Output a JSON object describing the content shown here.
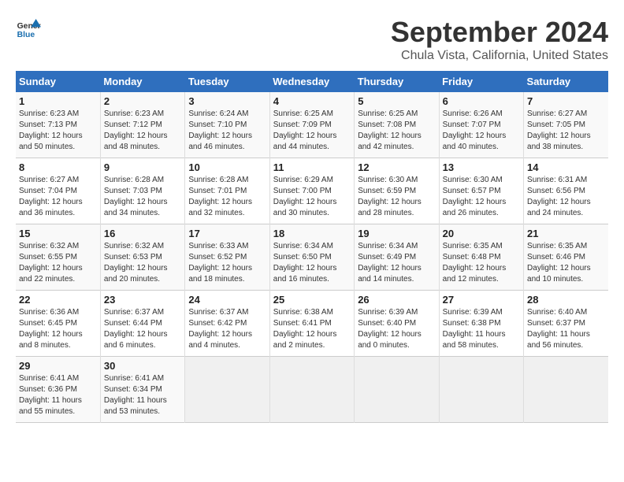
{
  "header": {
    "logo_line1": "General",
    "logo_line2": "Blue",
    "title": "September 2024",
    "subtitle": "Chula Vista, California, United States"
  },
  "columns": [
    "Sunday",
    "Monday",
    "Tuesday",
    "Wednesday",
    "Thursday",
    "Friday",
    "Saturday"
  ],
  "weeks": [
    [
      {
        "day": "1",
        "sunrise": "6:23 AM",
        "sunset": "7:13 PM",
        "daylight": "12 hours and 50 minutes."
      },
      {
        "day": "2",
        "sunrise": "6:23 AM",
        "sunset": "7:12 PM",
        "daylight": "12 hours and 48 minutes."
      },
      {
        "day": "3",
        "sunrise": "6:24 AM",
        "sunset": "7:10 PM",
        "daylight": "12 hours and 46 minutes."
      },
      {
        "day": "4",
        "sunrise": "6:25 AM",
        "sunset": "7:09 PM",
        "daylight": "12 hours and 44 minutes."
      },
      {
        "day": "5",
        "sunrise": "6:25 AM",
        "sunset": "7:08 PM",
        "daylight": "12 hours and 42 minutes."
      },
      {
        "day": "6",
        "sunrise": "6:26 AM",
        "sunset": "7:07 PM",
        "daylight": "12 hours and 40 minutes."
      },
      {
        "day": "7",
        "sunrise": "6:27 AM",
        "sunset": "7:05 PM",
        "daylight": "12 hours and 38 minutes."
      }
    ],
    [
      {
        "day": "8",
        "sunrise": "6:27 AM",
        "sunset": "7:04 PM",
        "daylight": "12 hours and 36 minutes."
      },
      {
        "day": "9",
        "sunrise": "6:28 AM",
        "sunset": "7:03 PM",
        "daylight": "12 hours and 34 minutes."
      },
      {
        "day": "10",
        "sunrise": "6:28 AM",
        "sunset": "7:01 PM",
        "daylight": "12 hours and 32 minutes."
      },
      {
        "day": "11",
        "sunrise": "6:29 AM",
        "sunset": "7:00 PM",
        "daylight": "12 hours and 30 minutes."
      },
      {
        "day": "12",
        "sunrise": "6:30 AM",
        "sunset": "6:59 PM",
        "daylight": "12 hours and 28 minutes."
      },
      {
        "day": "13",
        "sunrise": "6:30 AM",
        "sunset": "6:57 PM",
        "daylight": "12 hours and 26 minutes."
      },
      {
        "day": "14",
        "sunrise": "6:31 AM",
        "sunset": "6:56 PM",
        "daylight": "12 hours and 24 minutes."
      }
    ],
    [
      {
        "day": "15",
        "sunrise": "6:32 AM",
        "sunset": "6:55 PM",
        "daylight": "12 hours and 22 minutes."
      },
      {
        "day": "16",
        "sunrise": "6:32 AM",
        "sunset": "6:53 PM",
        "daylight": "12 hours and 20 minutes."
      },
      {
        "day": "17",
        "sunrise": "6:33 AM",
        "sunset": "6:52 PM",
        "daylight": "12 hours and 18 minutes."
      },
      {
        "day": "18",
        "sunrise": "6:34 AM",
        "sunset": "6:50 PM",
        "daylight": "12 hours and 16 minutes."
      },
      {
        "day": "19",
        "sunrise": "6:34 AM",
        "sunset": "6:49 PM",
        "daylight": "12 hours and 14 minutes."
      },
      {
        "day": "20",
        "sunrise": "6:35 AM",
        "sunset": "6:48 PM",
        "daylight": "12 hours and 12 minutes."
      },
      {
        "day": "21",
        "sunrise": "6:35 AM",
        "sunset": "6:46 PM",
        "daylight": "12 hours and 10 minutes."
      }
    ],
    [
      {
        "day": "22",
        "sunrise": "6:36 AM",
        "sunset": "6:45 PM",
        "daylight": "12 hours and 8 minutes."
      },
      {
        "day": "23",
        "sunrise": "6:37 AM",
        "sunset": "6:44 PM",
        "daylight": "12 hours and 6 minutes."
      },
      {
        "day": "24",
        "sunrise": "6:37 AM",
        "sunset": "6:42 PM",
        "daylight": "12 hours and 4 minutes."
      },
      {
        "day": "25",
        "sunrise": "6:38 AM",
        "sunset": "6:41 PM",
        "daylight": "12 hours and 2 minutes."
      },
      {
        "day": "26",
        "sunrise": "6:39 AM",
        "sunset": "6:40 PM",
        "daylight": "12 hours and 0 minutes."
      },
      {
        "day": "27",
        "sunrise": "6:39 AM",
        "sunset": "6:38 PM",
        "daylight": "11 hours and 58 minutes."
      },
      {
        "day": "28",
        "sunrise": "6:40 AM",
        "sunset": "6:37 PM",
        "daylight": "11 hours and 56 minutes."
      }
    ],
    [
      {
        "day": "29",
        "sunrise": "6:41 AM",
        "sunset": "6:36 PM",
        "daylight": "11 hours and 55 minutes."
      },
      {
        "day": "30",
        "sunrise": "6:41 AM",
        "sunset": "6:34 PM",
        "daylight": "11 hours and 53 minutes."
      },
      null,
      null,
      null,
      null,
      null
    ]
  ]
}
